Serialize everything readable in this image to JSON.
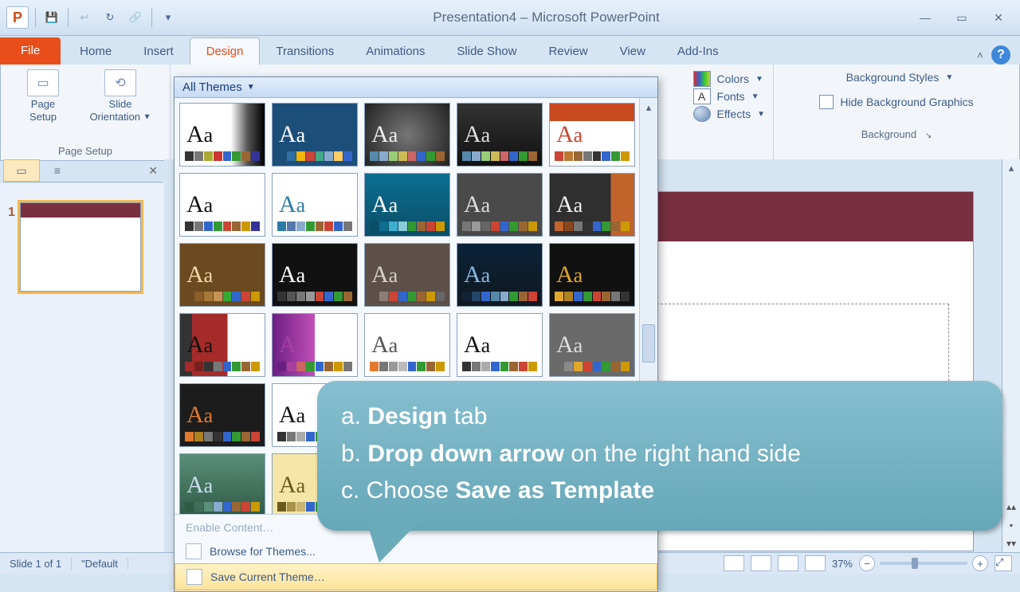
{
  "title": "Presentation4 – Microsoft PowerPoint",
  "app_letter": "P",
  "tabs": {
    "file": "File",
    "items": [
      "Home",
      "Insert",
      "Design",
      "Transitions",
      "Animations",
      "Slide Show",
      "Review",
      "View",
      "Add-Ins"
    ],
    "active": "Design"
  },
  "ribbon": {
    "page_setup_group": "Page Setup",
    "page_setup_btn": "Page\nSetup",
    "slide_orient_btn": "Slide\nOrientation",
    "colors": "Colors",
    "fonts": "Fonts",
    "effects": "Effects",
    "bg_styles": "Background Styles",
    "hide_bg": "Hide Background Graphics",
    "bg_group": "Background"
  },
  "gallery": {
    "header": "All Themes",
    "menu_enable": "Enable Content…",
    "menu_browse": "Browse for Themes...",
    "menu_save": "Save Current Theme…",
    "themes": [
      {
        "bg": "#ffffff",
        "fg": "#111",
        "grad": "linear-gradient(90deg,#fff 60%,#555 80%,#000)",
        "sw": [
          "#333",
          "#777",
          "#AA3",
          "#C33",
          "#36C",
          "#393",
          "#963",
          "#339"
        ]
      },
      {
        "bg": "#1C4E7A",
        "fg": "#fff",
        "grad": "",
        "sw": [
          "#1C4E7A",
          "#2F6FA3",
          "#F2B705",
          "#C43",
          "#4A8",
          "#8AC",
          "#FC6",
          "#36C"
        ]
      },
      {
        "bg": "#3A3A3A",
        "fg": "#eee",
        "grad": "radial-gradient(circle,#777,#222)",
        "sw": [
          "#58A",
          "#8AC",
          "#9C7",
          "#CB5",
          "#C66",
          "#36C",
          "#393",
          "#963"
        ]
      },
      {
        "bg": "#1C1C1C",
        "fg": "#ddd",
        "grad": "linear-gradient(#333,#111)",
        "sw": [
          "#58A",
          "#8AC",
          "#9C7",
          "#CB5",
          "#C66",
          "#36C",
          "#393",
          "#963"
        ]
      },
      {
        "bg": "#ffffff",
        "fg": "#C43",
        "grad": "linear-gradient(#C84A1F 0 28%,#fff 28%)",
        "sw": [
          "#C43",
          "#B73",
          "#963",
          "#777",
          "#333",
          "#36C",
          "#393",
          "#C90"
        ]
      },
      {
        "bg": "#ffffff",
        "fg": "#111",
        "grad": "",
        "sw": [
          "#333",
          "#777",
          "#36C",
          "#393",
          "#C43",
          "#963",
          "#C90",
          "#339"
        ]
      },
      {
        "bg": "#ffffff",
        "fg": "#2C7AA6",
        "grad": "",
        "sw": [
          "#2C7AA6",
          "#57A",
          "#8AC",
          "#393",
          "#963",
          "#C43",
          "#36C",
          "#777"
        ]
      },
      {
        "bg": "#0C6E91",
        "fg": "#fff",
        "grad": "linear-gradient(#0C6E91,#0A4F68)",
        "sw": [
          "#0A4F68",
          "#0C6E91",
          "#3FAFCF",
          "#8ACBDC",
          "#393",
          "#963",
          "#C43",
          "#C90"
        ]
      },
      {
        "bg": "#4A4A4A",
        "fg": "#ddd",
        "grad": "",
        "sw": [
          "#777",
          "#999",
          "#666",
          "#C43",
          "#36C",
          "#393",
          "#963",
          "#C90"
        ]
      },
      {
        "bg": "#2F2F2F",
        "fg": "#eee",
        "grad": "linear-gradient(90deg,#2F2F2F 72%,#C0642C 72%)",
        "sw": [
          "#C0642C",
          "#8A471F",
          "#777",
          "#333",
          "#36C",
          "#393",
          "#963",
          "#C90"
        ]
      },
      {
        "bg": "#6B4A1F",
        "fg": "#F0D9A8",
        "grad": "",
        "sw": [
          "#6B4A1F",
          "#8A5F2A",
          "#A8783A",
          "#C6935A",
          "#3A3",
          "#36C",
          "#C43",
          "#C90"
        ]
      },
      {
        "bg": "#111",
        "fg": "#fff",
        "grad": "",
        "sw": [
          "#333",
          "#555",
          "#777",
          "#999",
          "#C43",
          "#36C",
          "#393",
          "#963"
        ]
      },
      {
        "bg": "#5C5048",
        "fg": "#D8D0C8",
        "grad": "",
        "sw": [
          "#5C5048",
          "#8A7F74",
          "#C43",
          "#36C",
          "#393",
          "#963",
          "#C90",
          "#666"
        ]
      },
      {
        "bg": "#101820",
        "fg": "#8AB6E0",
        "grad": "linear-gradient(#0A2238,#101820)",
        "sw": [
          "#123",
          "#246",
          "#36C",
          "#58A",
          "#8AC",
          "#393",
          "#963",
          "#C43"
        ]
      },
      {
        "bg": "#111",
        "fg": "#E0A62C",
        "grad": "",
        "sw": [
          "#E0A62C",
          "#B0821F",
          "#36C",
          "#393",
          "#C43",
          "#963",
          "#777",
          "#333"
        ]
      },
      {
        "bg": "#ffffff",
        "fg": "#111",
        "grad": "linear-gradient(90deg,#333 0 14%,#A52A2A 14% 56%,#fff 56%)",
        "sw": [
          "#A52A2A",
          "#7A1F1F",
          "#333",
          "#777",
          "#36C",
          "#393",
          "#963",
          "#C90"
        ]
      },
      {
        "bg": "#ffffff",
        "fg": "#A83FA0",
        "grad": "linear-gradient(90deg,#6B1F83,#C24FB8 50%,#fff 50%)",
        "sw": [
          "#6B1F83",
          "#A83FA0",
          "#C66",
          "#393",
          "#36C",
          "#963",
          "#C90",
          "#777"
        ]
      },
      {
        "bg": "#ffffff",
        "fg": "#555",
        "grad": "",
        "sw": [
          "#E07A2C",
          "#777",
          "#999",
          "#bbb",
          "#36C",
          "#393",
          "#963",
          "#C90"
        ]
      },
      {
        "bg": "#ffffff",
        "fg": "#111",
        "grad": "",
        "sw": [
          "#333",
          "#777",
          "#AAA",
          "#36C",
          "#393",
          "#963",
          "#C43",
          "#C90"
        ]
      },
      {
        "bg": "#6A6A6A",
        "fg": "#ddd",
        "grad": "",
        "sw": [
          "#6A6A6A",
          "#8A8A8A",
          "#E0A62C",
          "#C43",
          "#36C",
          "#393",
          "#963",
          "#C90"
        ]
      },
      {
        "bg": "#1C1C1C",
        "fg": "#E07A2C",
        "grad": "",
        "sw": [
          "#E07A2C",
          "#B0821F",
          "#777",
          "#333",
          "#36C",
          "#393",
          "#963",
          "#C43"
        ]
      },
      {
        "bg": "#ffffff",
        "fg": "#111",
        "grad": "linear-gradient(90deg,#fff 72%,#555 72%)",
        "sw": [
          "#333",
          "#777",
          "#AAA",
          "#36C",
          "#393",
          "#963",
          "#C43",
          "#C90"
        ]
      },
      {
        "bg": "#CFE2F3",
        "fg": "#246",
        "grad": "",
        "sw": [
          "#246",
          "#58A",
          "#8AC",
          "#36C",
          "#393",
          "#963",
          "#C43",
          "#C90"
        ]
      },
      {
        "bg": "#ffffff",
        "fg": "#246",
        "grad": "linear-gradient(90deg,#fff 68%,#3A5F8A 68%)",
        "sw": [
          "#246",
          "#58A",
          "#8AC",
          "#36C",
          "#393",
          "#963",
          "#C43",
          "#C90"
        ]
      },
      {
        "bg": "#2F2F2F",
        "fg": "#8AC",
        "grad": "",
        "sw": [
          "#36C",
          "#58A",
          "#8AC",
          "#393",
          "#963",
          "#C43",
          "#C90",
          "#777"
        ]
      },
      {
        "bg": "#3F6F5A",
        "fg": "#CDE",
        "grad": "linear-gradient(#5A8F78,#2F5A46)",
        "sw": [
          "#2F5A46",
          "#3F6F5A",
          "#5A8F78",
          "#8AC",
          "#36C",
          "#963",
          "#C43",
          "#C90"
        ]
      },
      {
        "bg": "#F5E6A8",
        "fg": "#6B5A1F",
        "grad": "",
        "sw": [
          "#6B5A1F",
          "#A8924A",
          "#C9B56F",
          "#36C",
          "#393",
          "#963",
          "#C43",
          "#777"
        ]
      }
    ]
  },
  "thumb": {
    "number": "1"
  },
  "status": {
    "slide_of": "Slide 1 of 1",
    "theme": "\"Default",
    "zoom": "37%"
  },
  "callout": {
    "a_pre": "a. ",
    "a_b": "Design",
    "a_post": " tab",
    "b_pre": "b. ",
    "b_b": "Drop down arrow",
    "b_post": " on the right hand side",
    "c_pre": "c. Choose ",
    "c_b": "Save as Template",
    "c_post": ""
  }
}
